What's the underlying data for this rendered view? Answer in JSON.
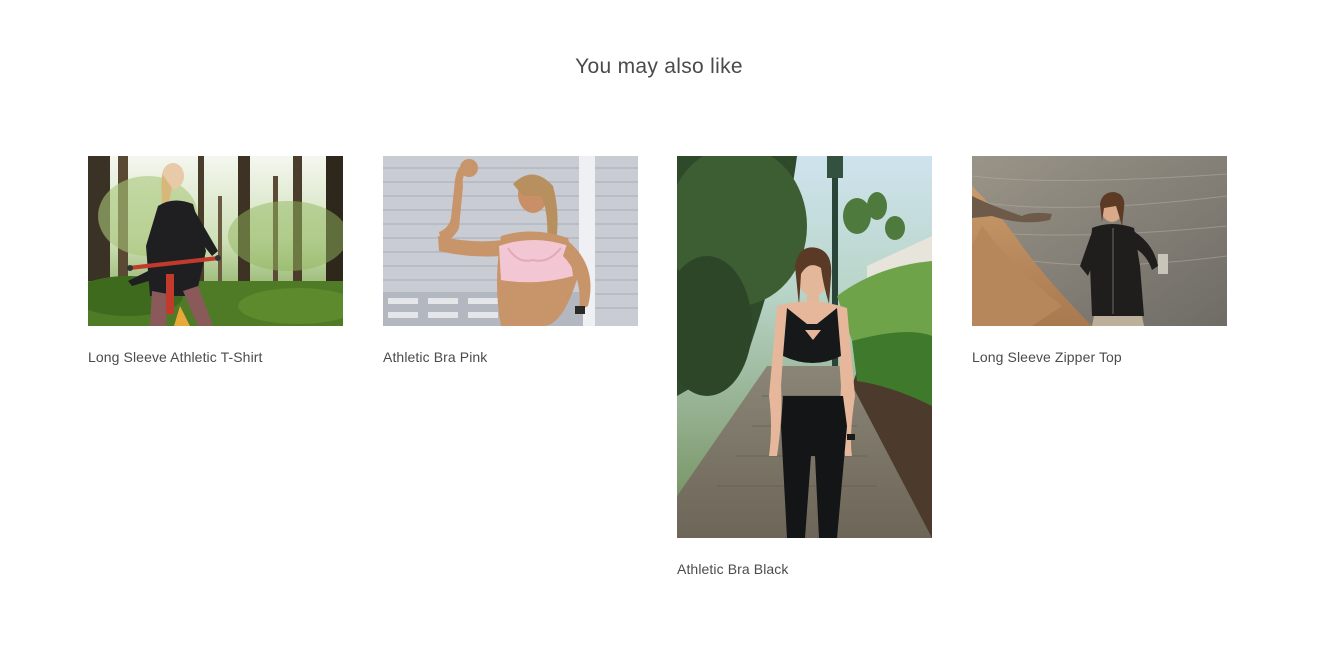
{
  "section": {
    "title": "You may also like"
  },
  "products": [
    {
      "title": "Long Sleeve Athletic T-Shirt",
      "image": "woman-on-bike-in-forest-photo"
    },
    {
      "title": "Athletic Bra Pink",
      "image": "woman-flexing-arm-pink-bra-photo"
    },
    {
      "title": "Athletic Bra Black",
      "image": "woman-black-bra-on-path-photo"
    },
    {
      "title": "Long Sleeve Zipper Top",
      "image": "woman-on-beach-zipper-top-photo"
    }
  ]
}
